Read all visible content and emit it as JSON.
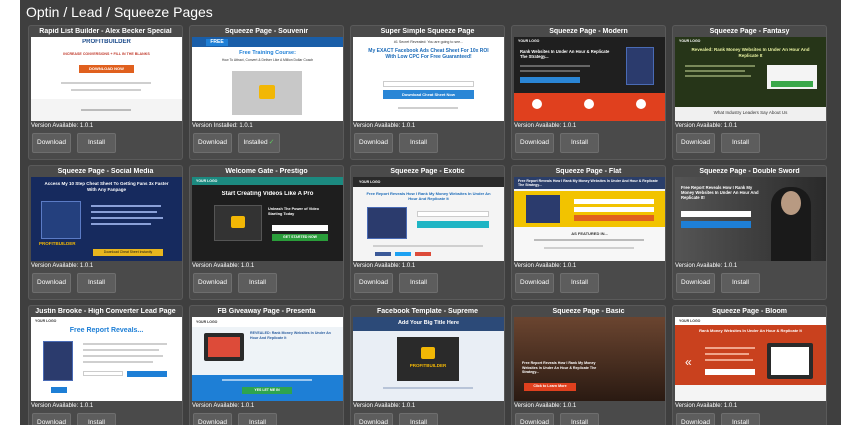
{
  "section": {
    "title": "Optin / Lead / Squeeze Pages"
  },
  "common": {
    "download": "Download",
    "install": "Install",
    "installed": "Installed"
  },
  "colors": {
    "panel": "#3f3f3f",
    "card": "#4a4a4a",
    "button": "#5d5d5d",
    "check": "#5fc95f"
  },
  "cards": [
    {
      "title": "Rapid List Builder - Alex Becker Special",
      "version": "Version Available: 1.0.1",
      "installed": false,
      "thumb": {
        "brand": "PROFITBUILDER",
        "headline": "INCREASE CONVERSIONS + FILL IN THE BLANKS",
        "cta": "DOWNLOAD NOW"
      }
    },
    {
      "title": "Squeeze Page - Souvenir",
      "version": "Version Installed: 1.0.1",
      "installed": true,
      "thumb": {
        "badge": "FREE",
        "headline": "Free Training Course:",
        "sub": "How To Attract, Convert & Deliver Like A Million Dollar Coach"
      }
    },
    {
      "title": "Super Simple Squeeze Page",
      "version": "Version Available: 1.0.1",
      "installed": false,
      "thumb": {
        "kicker": "#1 Secret Revealed: You are going to see...",
        "headline": "My EXACT Facebook Ads Cheat Sheet For 10x ROI With Low CPC For Free Guaranteed!",
        "cta": "Download Cheat Sheet Now"
      }
    },
    {
      "title": "Squeeze Page - Modern",
      "version": "Version Available: 1.0.1",
      "installed": false,
      "thumb": {
        "logo": "YOUR LOGO",
        "headline": "Rank Websites In Under An Hour & Replicate The Strategy..."
      }
    },
    {
      "title": "Squeeze Page - Fantasy",
      "version": "Version Available: 1.0.1",
      "installed": false,
      "thumb": {
        "logo": "YOUR LOGO",
        "headline": "Revealed: Rank Money Websites In Under An Hour And Replicate It",
        "footer": "What Industry Leaders Say About Us"
      }
    },
    {
      "title": "Squeeze Page - Social Media",
      "version": "Version Available: 1.0.1",
      "installed": false,
      "thumb": {
        "headline": "Access My 10 Step Cheat Sheet To Getting Fans 3x Faster With Any Fanpage",
        "brand": "PROFITBUILDER",
        "cta": "Download Cheat Sheet Instantly"
      }
    },
    {
      "title": "Welcome Gate - Prestigo",
      "version": "Version Available: 1.0.1",
      "installed": false,
      "thumb": {
        "logo": "YOUR LOGO",
        "headline": "Start Creating Videos Like A Pro",
        "sub": "Unleash The Power of Video Starting Today",
        "cta": "GET STARTED NOW"
      }
    },
    {
      "title": "Squeeze Page - Exotic",
      "version": "Version Available: 1.0.1",
      "installed": false,
      "thumb": {
        "logo": "YOUR LOGO",
        "headline": "Free Report Reveals How I Rank My Money Websites In Under An Hour And Replicate It"
      }
    },
    {
      "title": "Squeeze Page - Flat",
      "version": "Version Available: 1.0.1",
      "installed": false,
      "thumb": {
        "headline": "Free Report Reveals How I Rank My Money Websites In Under And Hour & Replicate The Strategy...",
        "sub": "AS FEATURED IN..."
      }
    },
    {
      "title": "Squeeze Page - Double Sword",
      "version": "Version Available: 1.0.1",
      "installed": false,
      "thumb": {
        "headline": "Free Report Reveals How I Rank My Money Websites In Under An Hour And Replicate It!"
      }
    },
    {
      "title": "Justin Brooke - High Converter Lead Page",
      "version": "Version Available: 1.0.1",
      "installed": false,
      "thumb": {
        "logo": "YOUR LOGO",
        "headline": "Free Report Reveals..."
      }
    },
    {
      "title": "FB Giveaway Page - Presenta",
      "version": "Version Available: 1.0.1",
      "installed": false,
      "thumb": {
        "logo": "YOUR LOGO",
        "headline": "REVEALED: Rank Money Websites In Under An Hour And Replicate It",
        "cta": "YES LET ME IN"
      }
    },
    {
      "title": "Facebook Template - Supreme",
      "version": "Version Available: 1.0.1",
      "installed": false,
      "thumb": {
        "headline": "Add Your Big Title Here",
        "brand": "PROFITBUILDER"
      }
    },
    {
      "title": "Squeeze Page - Basic",
      "version": "Version Available: 1.0.1",
      "installed": false,
      "thumb": {
        "headline": "Free Report Reveals How I Rank My Money Websites In Under An Hour & Replicate The Strategy...",
        "cta": "Click to Learn More"
      }
    },
    {
      "title": "Squeeze Page - Bloom",
      "version": "Version Available: 1.0.1",
      "installed": false,
      "thumb": {
        "logo": "YOUR LOGO",
        "headline": "Rank Money Websites In Under An Hour & Replicate It"
      }
    }
  ]
}
